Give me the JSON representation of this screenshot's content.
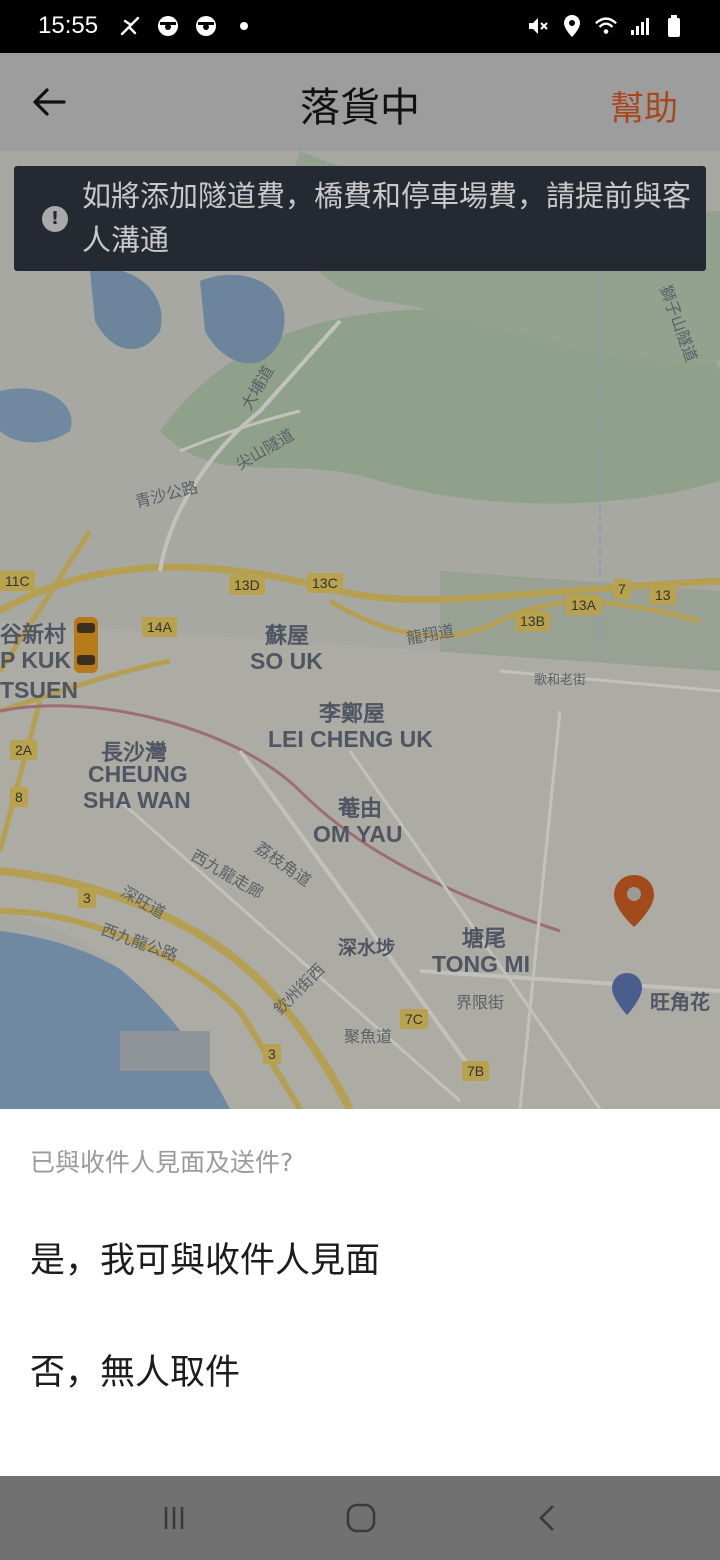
{
  "status_bar": {
    "time": "15:55",
    "left_icons": [
      "flight-icon",
      "steering-wheel-icon",
      "steering-wheel-icon",
      "dot-icon"
    ],
    "right_icons": [
      "mute-icon",
      "location-icon",
      "wifi-icon",
      "signal-icon",
      "battery-icon"
    ]
  },
  "header": {
    "title": "落貨中",
    "help_label": "幫助",
    "accent_color": "#a8471b"
  },
  "notice": {
    "icon": "alert-icon",
    "text": "如將添加隧道費，橋費和停車場費，請提前與客人溝通"
  },
  "map": {
    "labels": {
      "so_uk_cn": "蘇屋",
      "so_uk_en": "SO UK",
      "lei_cheng_uk_cn": "李鄭屋",
      "lei_cheng_uk_en": "LEI CHENG UK",
      "cheung_sha_wan_cn": "長沙灣",
      "cheung_sha_wan_en1": "CHEUNG",
      "cheung_sha_wan_en2": "SHA WAN",
      "om_yau_cn": "菴由",
      "om_yau_en": "OM YAU",
      "tong_mi_cn": "塘尾",
      "tong_mi_en": "TONG MI",
      "sham_shui_po": "深水埗",
      "pak_tin_cn": "谷新村",
      "pak_tin_en1": "P KUK",
      "pak_tin_en2": "TSUEN",
      "mong_kok": "旺角花",
      "ching_sha_road": "青沙公路",
      "tsim_shan_tunnel": "尖山隧道",
      "tai_po_road": "大埔道",
      "lung_cheung_road": "龍翔道",
      "west_kowloon_corridor": "西九龍走廊",
      "west_kowloon_highway": "西九龍公路",
      "lai_chi_kok_road": "荔枝角道",
      "yen_chow_street": "欽州街西",
      "shum_wong_road": "深旺道",
      "boundary_street": "界限街",
      "tsui_yu_road": "聚魚道",
      "lion_rock_tunnel": "獅子山隧道",
      "dragon_road": "歌和老街"
    },
    "route_badges": [
      "11C",
      "13D",
      "13C",
      "14A",
      "13B",
      "13A",
      "7",
      "13",
      "2A",
      "8",
      "3",
      "7C",
      "7B",
      "3"
    ]
  },
  "sheet": {
    "question": "已與收件人見面及送件?",
    "option_yes": "是，我可與收件人見面",
    "option_no": "否，無人取件"
  },
  "nav_bar": {
    "recents_icon": "recents-icon",
    "home_icon": "home-icon",
    "back_icon": "back-icon"
  }
}
